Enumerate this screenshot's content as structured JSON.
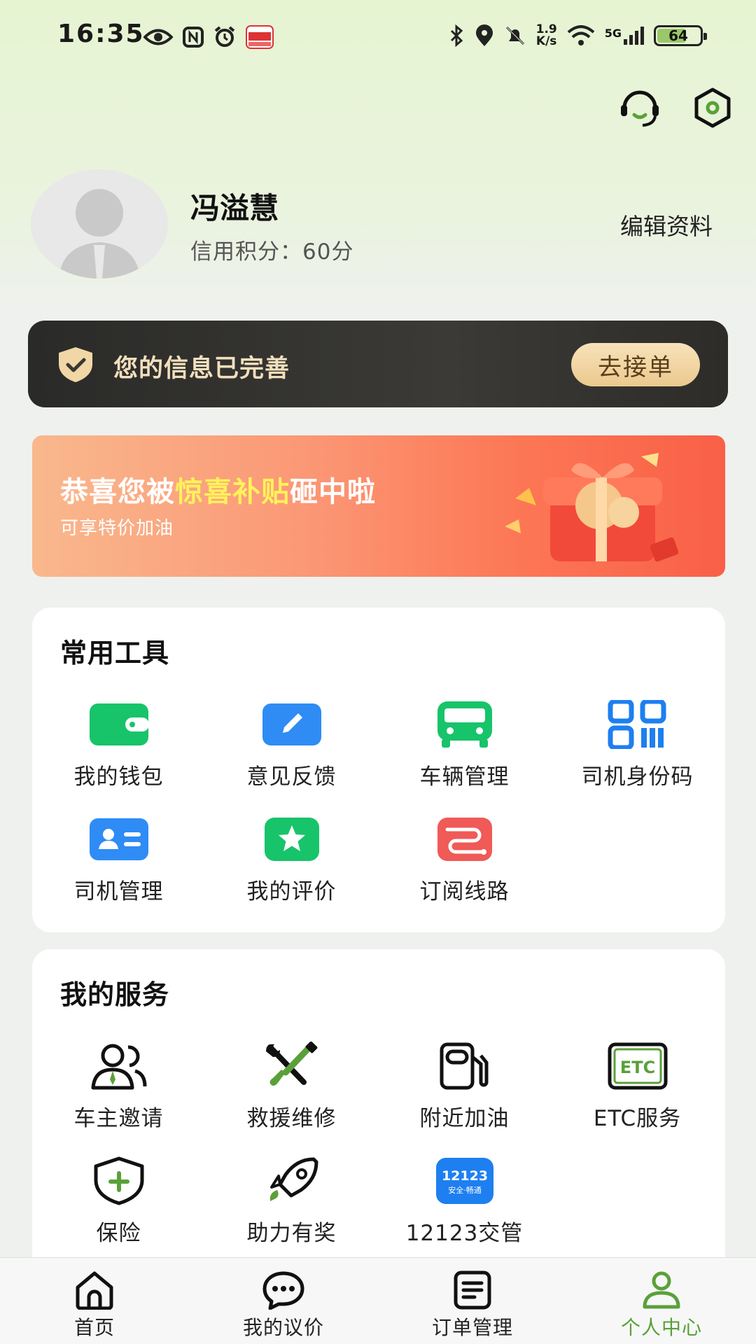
{
  "status_bar": {
    "time": "16:35",
    "net_speed_top": "1.9",
    "net_speed_bottom": "K/s",
    "network": "5G",
    "battery": "64",
    "battery_level": 0.64
  },
  "header": {
    "support_icon": "headset-icon",
    "settings_icon": "hexagon-settings-icon"
  },
  "profile": {
    "name": "冯溢慧",
    "credit": "信用积分：60分",
    "edit_label": "编辑资料"
  },
  "info_banner": {
    "text": "您的信息已完善",
    "button": "去接单"
  },
  "promo": {
    "title_prefix": "恭喜您被",
    "title_highlight": "惊喜补贴",
    "title_suffix": "砸中啦",
    "subtitle": "可享特价加油"
  },
  "tools": {
    "title": "常用工具",
    "items": [
      {
        "label": "我的钱包",
        "icon": "wallet-icon"
      },
      {
        "label": "意见反馈",
        "icon": "feedback-pen-icon"
      },
      {
        "label": "车辆管理",
        "icon": "bus-icon"
      },
      {
        "label": "司机身份码",
        "icon": "qr-code-icon"
      },
      {
        "label": "司机管理",
        "icon": "id-card-icon"
      },
      {
        "label": "我的评价",
        "icon": "star-icon"
      },
      {
        "label": "订阅线路",
        "icon": "route-icon"
      }
    ]
  },
  "services": {
    "title": "我的服务",
    "items": [
      {
        "label": "车主邀请",
        "icon": "invite-users-icon"
      },
      {
        "label": "救援维修",
        "icon": "repair-tools-icon"
      },
      {
        "label": "附近加油",
        "icon": "fuel-pump-icon"
      },
      {
        "label": "ETC服务",
        "icon": "etc-icon",
        "icon_text": "ETC"
      },
      {
        "label": "保险",
        "icon": "insurance-shield-icon"
      },
      {
        "label": "助力有奖",
        "icon": "rocket-icon"
      },
      {
        "label": "12123交管",
        "icon": "traffic-12123-icon",
        "icon_text": "12123",
        "icon_sub": "安全·畅通"
      }
    ]
  },
  "bottom_nav": {
    "items": [
      {
        "label": "首页",
        "icon": "home-icon",
        "active": false
      },
      {
        "label": "我的议价",
        "icon": "chat-bubble-icon",
        "active": false
      },
      {
        "label": "订单管理",
        "icon": "order-list-icon",
        "active": false
      },
      {
        "label": "个人中心",
        "icon": "person-icon",
        "active": true
      }
    ]
  },
  "colors": {
    "accent_green": "#5aa03a",
    "wallet_green": "#17c46a",
    "feedback_blue": "#2f8cf5",
    "red_route": "#f05a57",
    "gold_text": "#f3dfbd"
  }
}
